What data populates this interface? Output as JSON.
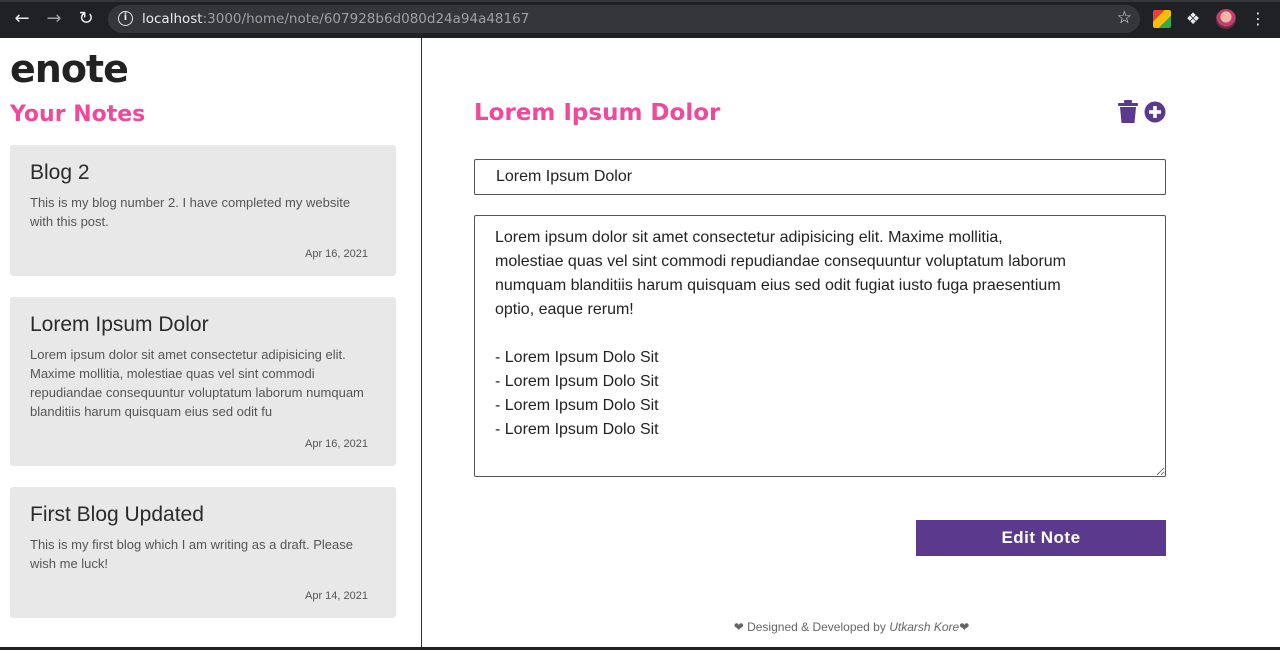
{
  "browser": {
    "url_host": "localhost",
    "url_path": ":3000/home/note/607928b6d080d24a94a48167"
  },
  "sidebar": {
    "brand": "enote",
    "heading": "Your Notes",
    "notes": [
      {
        "title": "Blog 2",
        "excerpt": "This is my blog number 2. I have completed my website with this post.",
        "date": "Apr 16, 2021"
      },
      {
        "title": "Lorem Ipsum Dolor",
        "excerpt": "Lorem ipsum dolor sit amet consectetur adipisicing elit. Maxime mollitia, molestiae quas vel sint commodi repudiandae consequuntur voluptatum laborum numquam blanditiis harum quisquam eius sed odit fu",
        "date": "Apr 16, 2021"
      },
      {
        "title": "First Blog Updated",
        "excerpt": "This is my first blog which I am writing as a draft. Please wish me luck!",
        "date": "Apr 14, 2021"
      }
    ]
  },
  "editor": {
    "heading": "Lorem Ipsum Dolor",
    "title_value": "Lorem Ipsum Dolor",
    "body_value": "Lorem ipsum dolor sit amet consectetur adipisicing elit. Maxime mollitia,\nmolestiae quas vel sint commodi repudiandae consequuntur voluptatum laborum\nnumquam blanditiis harum quisquam eius sed odit fugiat iusto fuga praesentium\noptio, eaque rerum!\n\n- Lorem Ipsum Dolo Sit\n- Lorem Ipsum Dolo Sit\n- Lorem Ipsum Dolo Sit\n- Lorem Ipsum Dolo Sit",
    "edit_button": "Edit Note",
    "delete_icon": "trash-icon",
    "add_icon": "plus-circle-icon"
  },
  "footer": {
    "prefix": "Designed & Developed by",
    "author": "Utkarsh Kore"
  },
  "colors": {
    "accent_pink": "#f0499a",
    "button_purple": "#5b3a8e",
    "card_bg": "#e8e8e8"
  }
}
